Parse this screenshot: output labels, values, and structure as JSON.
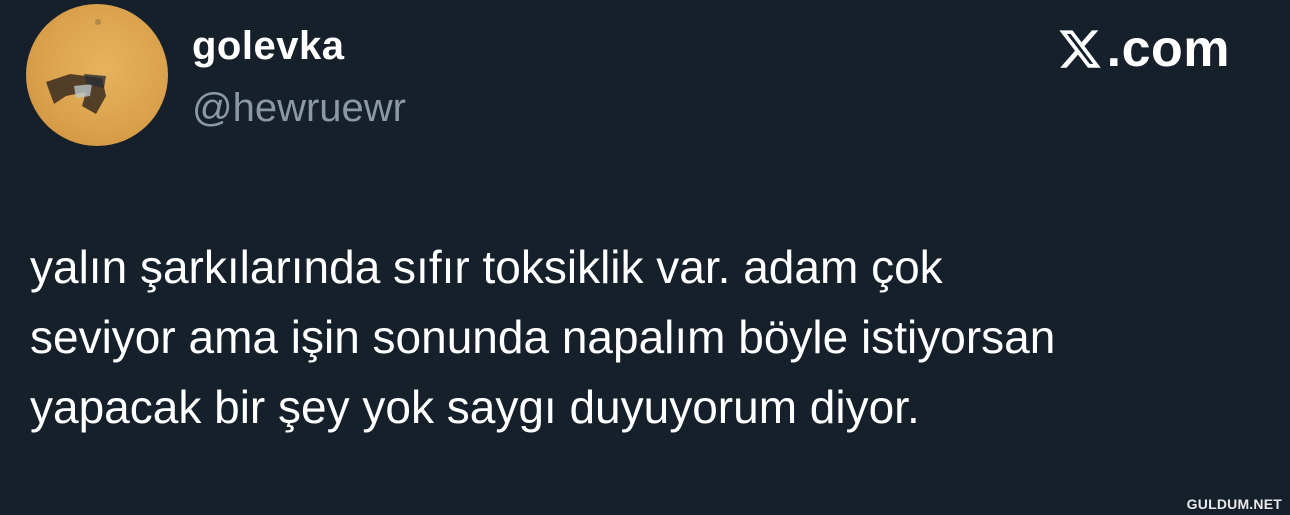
{
  "author": {
    "display_name": "golevka",
    "handle": "@hewruewr"
  },
  "brand": {
    "label": ".com",
    "icon": "x-logo-icon"
  },
  "tweet": {
    "text": "yalın şarkılarında sıfır toksiklik var. adam çok\nseviyor ama işin sonunda napalım böyle istiyorsan\nyapacak bir şey yok saygı duyuyorum diyor."
  },
  "watermark": {
    "text": "GULDUM.NET"
  },
  "colors": {
    "background": "#15202b",
    "primary_text": "#ffffff",
    "secondary_text": "#8b98a5",
    "avatar": "#dba24d"
  }
}
